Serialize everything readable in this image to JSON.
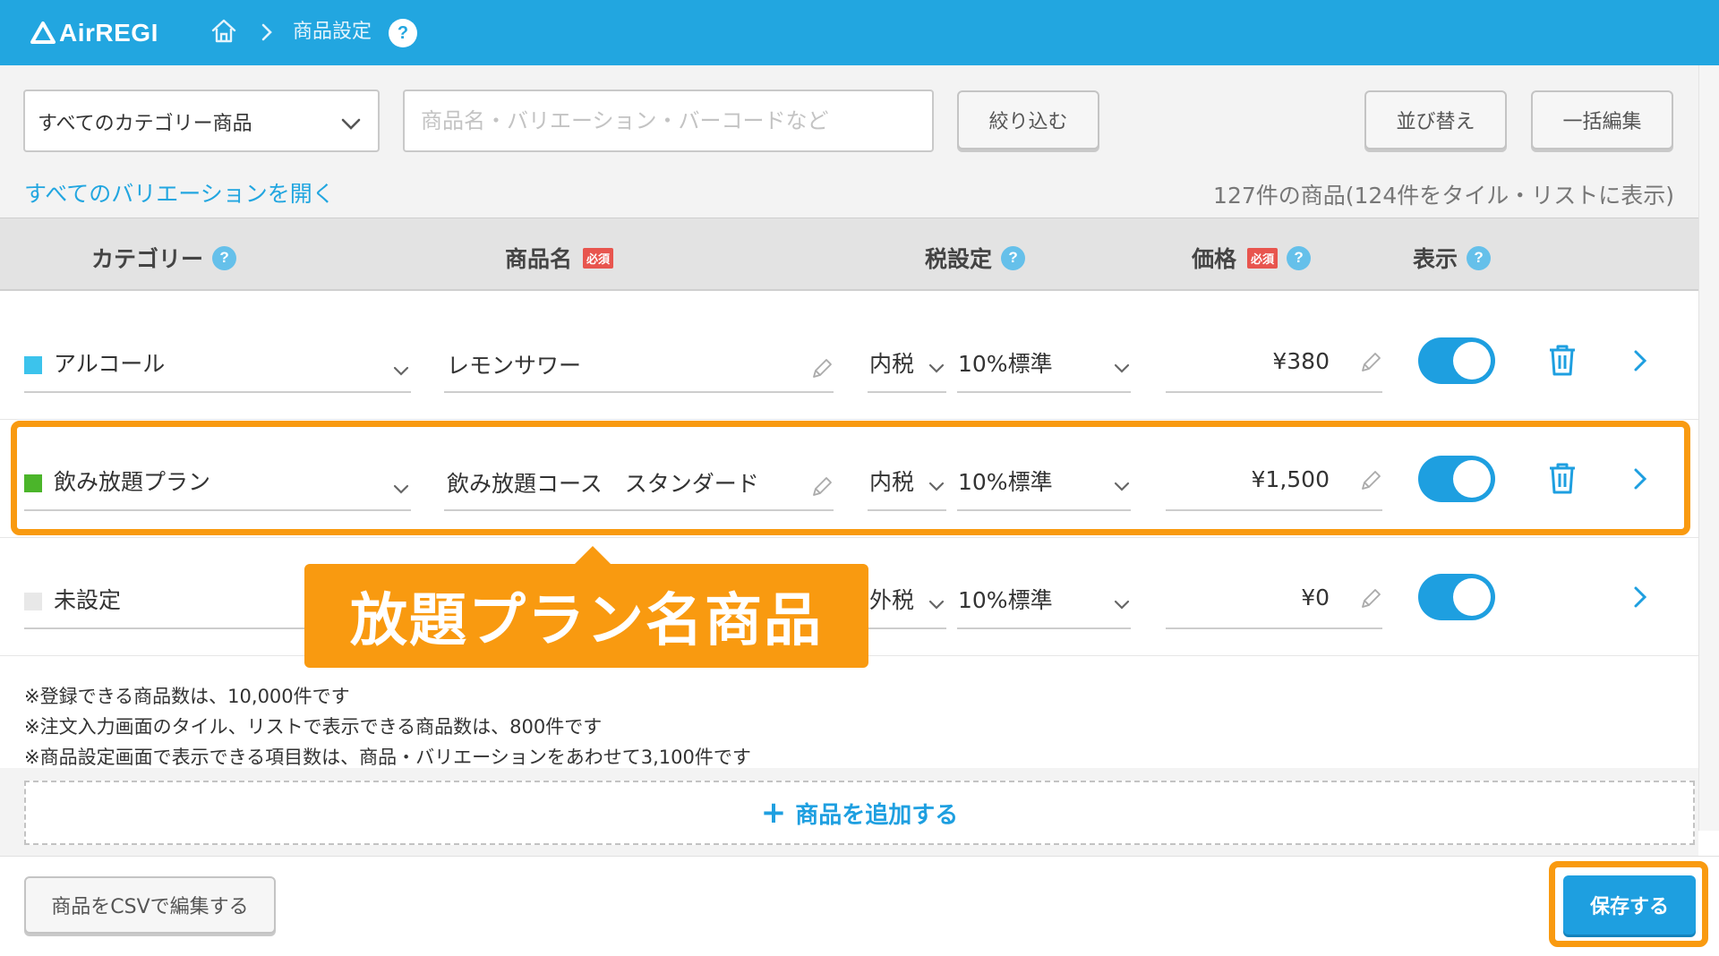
{
  "header": {
    "logo_text": "AirREGI",
    "breadcrumb_current": "商品設定",
    "help_glyph": "?"
  },
  "toolbar": {
    "category_select_value": "すべてのカテゴリー商品",
    "search_placeholder": "商品名・バリエーション・バーコードなど",
    "filter_button": "絞り込む",
    "sort_button": "並び替え",
    "bulk_edit_button": "一括編集"
  },
  "expand_all_link": "すべてのバリエーションを開く",
  "product_count_text": "127件の商品(124件をタイル・リストに表示)",
  "table": {
    "columns": {
      "category": "カテゴリー",
      "name": "商品名",
      "tax": "税設定",
      "price": "価格",
      "display": "表示"
    },
    "required_badge": "必須",
    "rows": [
      {
        "category": "アルコール",
        "category_color": "#3cc3ec",
        "name": "レモンサワー",
        "tax_type": "内税",
        "tax_rate": "10%標準",
        "price": "¥380",
        "display_on": true
      },
      {
        "category": "飲み放題プラン",
        "category_color": "#4bb52a",
        "name": "飲み放題コース　スタンダード",
        "tax_type": "内税",
        "tax_rate": "10%標準",
        "price": "¥1,500",
        "display_on": true
      },
      {
        "category": "未設定",
        "category_color": "#e8e8e8",
        "name": "",
        "tax_type": "外税",
        "tax_rate": "10%標準",
        "price": "¥0",
        "display_on": true
      }
    ]
  },
  "callout": {
    "text": "放題プラン名商品",
    "color": "#f99a10"
  },
  "notes": [
    "※登録できる商品数は、10,000件です",
    "※注文入力画面のタイル、リストで表示できる商品数は、800件です",
    "※商品設定画面で表示できる項目数は、商品・バリエーションをあわせて3,100件です"
  ],
  "add_product": {
    "plus": "+",
    "label": "商品を追加する"
  },
  "footer": {
    "csv_button": "商品をCSVで編集する",
    "save_button": "保存する"
  },
  "colors": {
    "header_blue": "#22a6e0",
    "accent_blue": "#1e9fe0",
    "highlight_orange": "#f99a10"
  }
}
